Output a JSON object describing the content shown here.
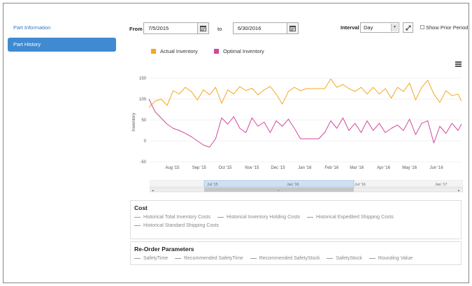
{
  "sidebar": {
    "items": [
      {
        "label": "Part Information",
        "active": false
      },
      {
        "label": "Part History",
        "active": true
      }
    ]
  },
  "filters": {
    "from_label": "From",
    "from_value": "7/5/2015",
    "to_label": "to",
    "to_value": "6/30/2016",
    "interval_label": "Interval",
    "interval_value": "Day",
    "show_prior_label": "Show Prior Period",
    "show_prior_checked": false
  },
  "icons": {
    "calendar": "calendar-icon",
    "expand": "expand-icon",
    "menu": "hamburger-menu-icon",
    "dropdown": "chevron-down-icon"
  },
  "colors": {
    "actual": "#f5a623",
    "optimal": "#d0499b",
    "accent": "#3f8ad0",
    "navigator_highlight": "#cfe0f3"
  },
  "chart_data": {
    "type": "line",
    "title": "",
    "xlabel": "",
    "ylabel": "Inventory",
    "ylim": [
      -50,
      150
    ],
    "yticks": [
      "150",
      "100",
      "50",
      "0",
      "-50"
    ],
    "yticks_values": [
      150,
      100,
      50,
      0,
      -50
    ],
    "xticks": [
      "Aug '15",
      "Sep '15",
      "Oct '15",
      "Nov '15",
      "Dec '15",
      "Jan '16",
      "Feb '16",
      "Mar '16",
      "Apr '16",
      "May '16",
      "Jun '16"
    ],
    "xticks_values": [
      "2015-08-01",
      "2015-09-01",
      "2015-10-01",
      "2015-11-01",
      "2015-12-01",
      "2016-01-01",
      "2016-02-01",
      "2016-03-01",
      "2016-04-01",
      "2016-05-01",
      "2016-06-01"
    ],
    "x_range": [
      "2015-07-05",
      "2016-06-30"
    ],
    "grid": true,
    "legend_position": "top-left",
    "series": [
      {
        "name": "Actual Inventory",
        "x": [
          "2015-07-05",
          "2015-07-12",
          "2015-07-19",
          "2015-07-26",
          "2015-08-02",
          "2015-08-09",
          "2015-08-16",
          "2015-08-23",
          "2015-08-30",
          "2015-09-06",
          "2015-09-13",
          "2015-09-20",
          "2015-09-27",
          "2015-10-04",
          "2015-10-11",
          "2015-10-18",
          "2015-10-25",
          "2015-11-01",
          "2015-11-08",
          "2015-11-15",
          "2015-11-22",
          "2015-11-29",
          "2015-12-06",
          "2015-12-13",
          "2015-12-20",
          "2015-12-27",
          "2016-01-03",
          "2016-01-10",
          "2016-01-17",
          "2016-01-24",
          "2016-01-31",
          "2016-02-07",
          "2016-02-14",
          "2016-02-21",
          "2016-02-28",
          "2016-03-06",
          "2016-03-13",
          "2016-03-20",
          "2016-03-27",
          "2016-04-03",
          "2016-04-10",
          "2016-04-17",
          "2016-04-24",
          "2016-05-01",
          "2016-05-08",
          "2016-05-15",
          "2016-05-22",
          "2016-05-29",
          "2016-06-05",
          "2016-06-12",
          "2016-06-19",
          "2016-06-26",
          "2016-06-30"
        ],
        "values": [
          80,
          95,
          100,
          85,
          120,
          112,
          128,
          118,
          98,
          122,
          110,
          128,
          90,
          122,
          112,
          130,
          120,
          126,
          110,
          122,
          130,
          112,
          88,
          118,
          128,
          120,
          125,
          125,
          125,
          125,
          148,
          128,
          135,
          125,
          118,
          128,
          112,
          128,
          112,
          125,
          102,
          128,
          118,
          138,
          98,
          128,
          145,
          112,
          92,
          120,
          108,
          112,
          95
        ]
      },
      {
        "name": "Optimal Inventory",
        "x": [
          "2015-07-05",
          "2015-07-12",
          "2015-07-19",
          "2015-07-26",
          "2015-08-02",
          "2015-08-09",
          "2015-08-16",
          "2015-08-23",
          "2015-08-30",
          "2015-09-06",
          "2015-09-13",
          "2015-09-20",
          "2015-09-27",
          "2015-10-04",
          "2015-10-11",
          "2015-10-18",
          "2015-10-25",
          "2015-11-01",
          "2015-11-08",
          "2015-11-15",
          "2015-11-22",
          "2015-11-29",
          "2015-12-06",
          "2015-12-13",
          "2015-12-20",
          "2015-12-27",
          "2016-01-03",
          "2016-01-10",
          "2016-01-17",
          "2016-01-24",
          "2016-01-31",
          "2016-02-07",
          "2016-02-14",
          "2016-02-21",
          "2016-02-28",
          "2016-03-06",
          "2016-03-13",
          "2016-03-20",
          "2016-03-27",
          "2016-04-03",
          "2016-04-10",
          "2016-04-17",
          "2016-04-24",
          "2016-05-01",
          "2016-05-08",
          "2016-05-15",
          "2016-05-22",
          "2016-05-29",
          "2016-06-05",
          "2016-06-12",
          "2016-06-19",
          "2016-06-26",
          "2016-06-30"
        ],
        "values": [
          100,
          70,
          55,
          40,
          30,
          25,
          18,
          10,
          0,
          -10,
          -15,
          5,
          55,
          40,
          58,
          30,
          20,
          55,
          35,
          45,
          20,
          48,
          35,
          52,
          30,
          5,
          5,
          5,
          5,
          20,
          48,
          30,
          55,
          25,
          42,
          20,
          48,
          25,
          42,
          20,
          30,
          38,
          25,
          52,
          15,
          42,
          48,
          -5,
          35,
          18,
          42,
          25,
          40
        ]
      }
    ]
  },
  "navigator": {
    "labels": [
      "Jul '15",
      "Jan '16",
      "Jul '16",
      "Jan '17"
    ]
  },
  "cost_panel": {
    "title": "Cost",
    "items": [
      "Historical Total Inventory Costs",
      "Historical Inventory Holding Costs",
      "Historical Expedited Shipping Costs",
      "Historical Standard Shipping Costs"
    ]
  },
  "reorder_panel": {
    "title": "Re-Order Parameters",
    "items": [
      "SafetyTime",
      "Recommended SafetyTime",
      "Recommended SafetyStock",
      "SafetyStock",
      "Rounding Value"
    ]
  }
}
